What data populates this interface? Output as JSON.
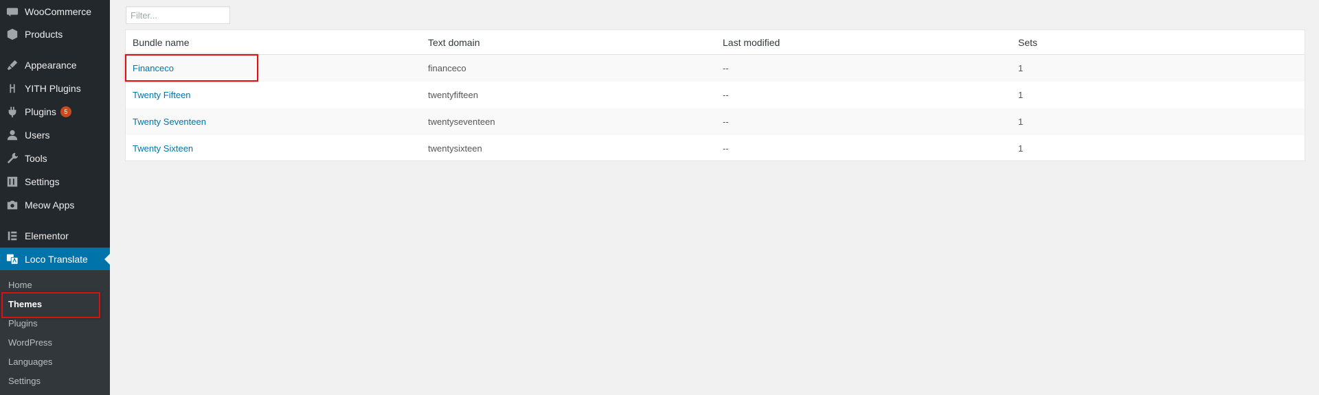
{
  "sidebar": {
    "items": [
      {
        "label": "WooCommerce",
        "icon": "woocommerce-icon"
      },
      {
        "label": "Products",
        "icon": "products-icon"
      },
      {
        "label": "Appearance",
        "icon": "appearance-icon"
      },
      {
        "label": "YITH Plugins",
        "icon": "yith-icon"
      },
      {
        "label": "Plugins",
        "icon": "plugins-icon",
        "badge": "5"
      },
      {
        "label": "Users",
        "icon": "users-icon"
      },
      {
        "label": "Tools",
        "icon": "tools-icon"
      },
      {
        "label": "Settings",
        "icon": "settings-icon"
      },
      {
        "label": "Meow Apps",
        "icon": "camera-icon"
      },
      {
        "label": "Elementor",
        "icon": "elementor-icon"
      },
      {
        "label": "Loco Translate",
        "icon": "translate-icon",
        "current": true
      }
    ],
    "submenu": [
      {
        "label": "Home"
      },
      {
        "label": "Themes",
        "active": true
      },
      {
        "label": "Plugins"
      },
      {
        "label": "WordPress"
      },
      {
        "label": "Languages"
      },
      {
        "label": "Settings"
      }
    ]
  },
  "filter": {
    "placeholder": "Filter...",
    "value": ""
  },
  "table": {
    "headers": [
      "Bundle name",
      "Text domain",
      "Last modified",
      "Sets"
    ],
    "rows": [
      {
        "name": "Financeco",
        "domain": "financeco",
        "modified": "--",
        "sets": "1"
      },
      {
        "name": "Twenty Fifteen",
        "domain": "twentyfifteen",
        "modified": "--",
        "sets": "1"
      },
      {
        "name": "Twenty Seventeen",
        "domain": "twentyseventeen",
        "modified": "--",
        "sets": "1"
      },
      {
        "name": "Twenty Sixteen",
        "domain": "twentysixteen",
        "modified": "--",
        "sets": "1"
      }
    ]
  },
  "colors": {
    "sidebar_bg": "#23282d",
    "submenu_bg": "#32373c",
    "accent": "#0073aa",
    "badge": "#ca4a1f",
    "highlight": "#dd1111"
  }
}
